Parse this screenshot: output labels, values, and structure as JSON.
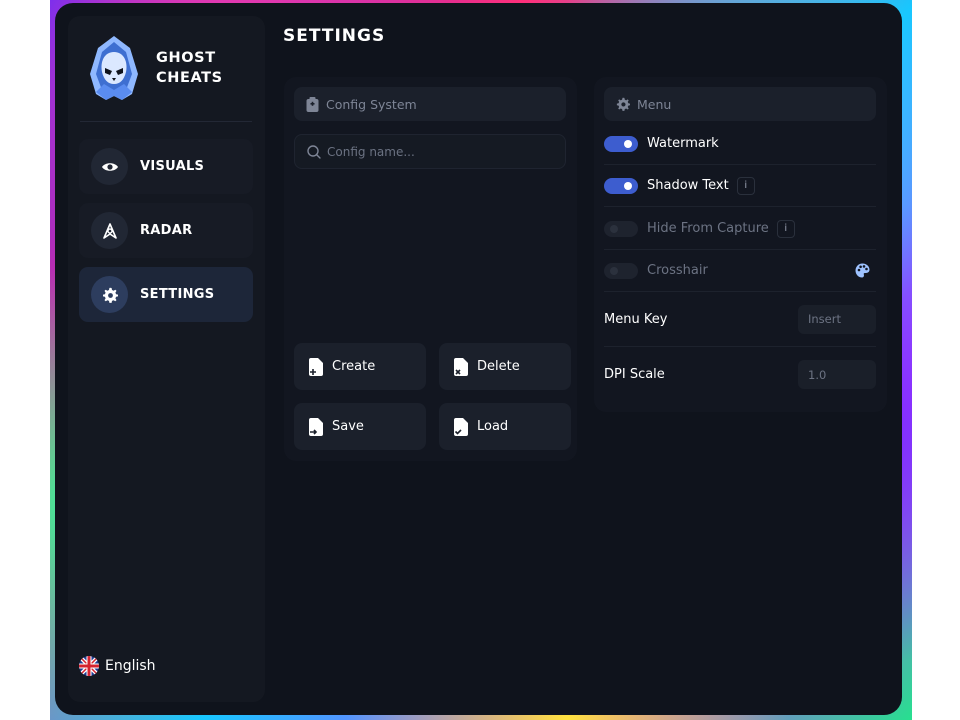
{
  "brand": {
    "line1": "GHOST",
    "line2": "CHEATS",
    "logo_icon": "hooded-skull-logo"
  },
  "nav": [
    {
      "label": "VISUALS",
      "icon": "eye-icon",
      "active": false
    },
    {
      "label": "RADAR",
      "icon": "radar-icon",
      "active": false
    },
    {
      "label": "SETTINGS",
      "icon": "gear-icon",
      "active": true
    }
  ],
  "language": {
    "label": "English",
    "icon": "uk-flag-icon"
  },
  "page": {
    "title": "SETTINGS"
  },
  "config": {
    "header": "Config System",
    "search_placeholder": "Config name...",
    "buttons": {
      "create": "Create",
      "delete": "Delete",
      "save": "Save",
      "load": "Load"
    }
  },
  "menu": {
    "header": "Menu",
    "watermark": {
      "label": "Watermark",
      "on": true
    },
    "shadow_text": {
      "label": "Shadow Text",
      "on": true,
      "info": "i"
    },
    "hide_from_capture": {
      "label": "Hide From Capture",
      "on": false,
      "info": "i"
    },
    "crosshair": {
      "label": "Crosshair",
      "on": false
    },
    "menu_key": {
      "label": "Menu Key",
      "value": "Insert"
    },
    "dpi_scale": {
      "label": "DPI Scale",
      "value": "1.0"
    }
  },
  "colors": {
    "accent": "#3d5dcf",
    "window_bg": "#0f131c",
    "panel_bg": "#121620"
  }
}
